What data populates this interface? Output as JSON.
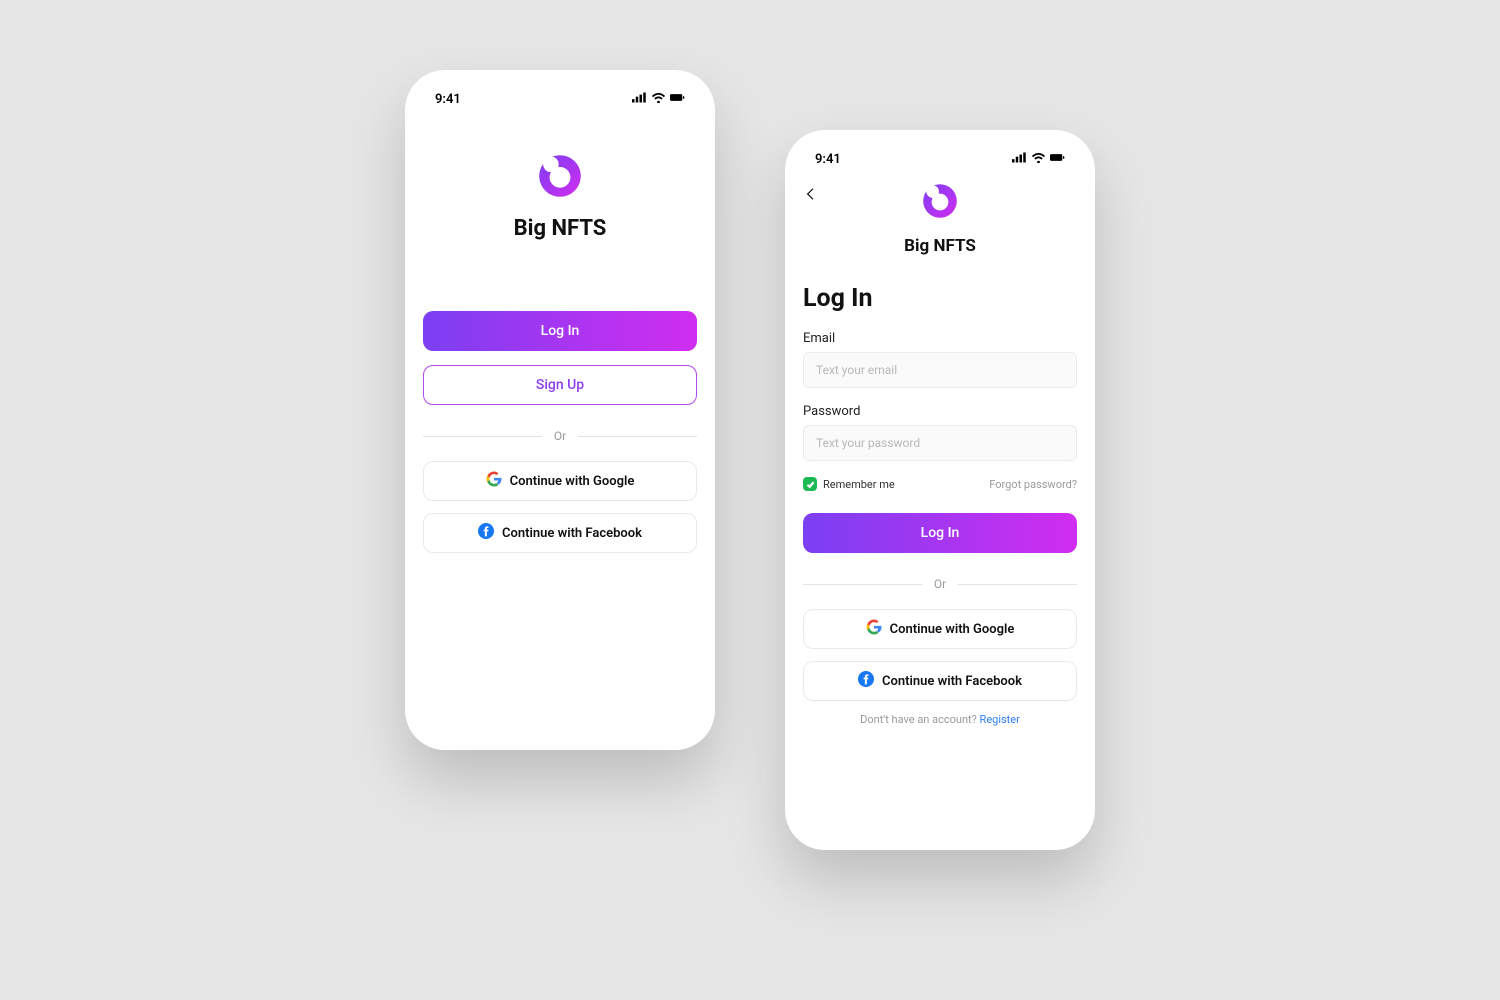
{
  "status": {
    "time": "9:41"
  },
  "brand": "Big NFTS",
  "colors": {
    "gradient_start": "#7b3ff2",
    "gradient_end": "#d12df0",
    "outline": "#b34af0"
  },
  "screen1": {
    "login_label": "Log In",
    "signup_label": "Sign Up",
    "or_label": "Or",
    "google_label": "Continue with Google",
    "facebook_label": "Continue with Facebook"
  },
  "screen2": {
    "title": "Log In",
    "email": {
      "label": "Email",
      "placeholder": "Text your email",
      "value": ""
    },
    "password": {
      "label": "Password",
      "placeholder": "Text your password",
      "value": ""
    },
    "remember_label": "Remember me",
    "remember_checked": true,
    "forgot_label": "Forgot password?",
    "submit_label": "Log In",
    "or_label": "Or",
    "google_label": "Continue with Google",
    "facebook_label": "Continue with Facebook",
    "footer_text": "Dont't have an account? ",
    "footer_link": "Register"
  }
}
